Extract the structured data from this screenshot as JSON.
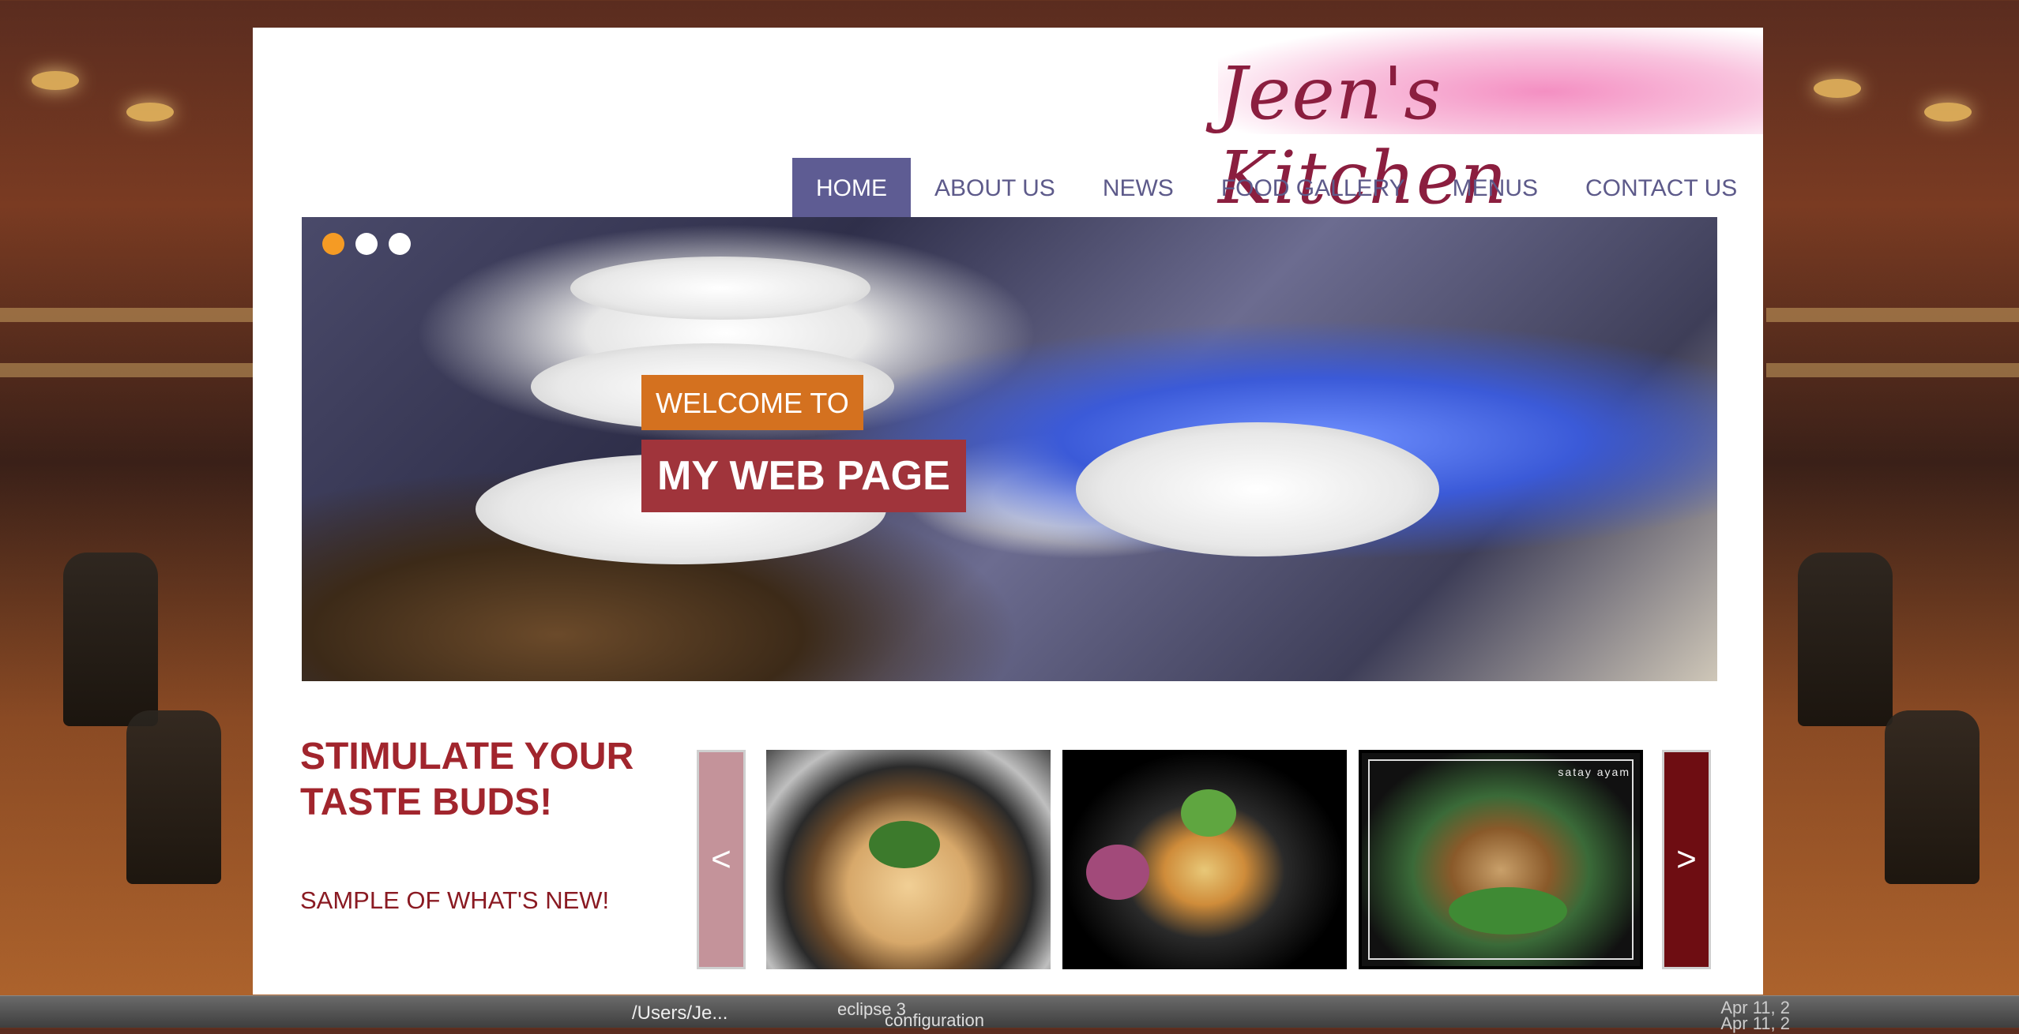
{
  "site": {
    "brand": "Jeen's Kitchen"
  },
  "nav": {
    "items": [
      {
        "label": "HOME",
        "active": true
      },
      {
        "label": "ABOUT US",
        "active": false
      },
      {
        "label": "NEWS",
        "active": false
      },
      {
        "label": "FOOD GALLERY",
        "active": false
      },
      {
        "label": "MENUS",
        "active": false
      },
      {
        "label": "CONTACT US",
        "active": false
      }
    ]
  },
  "hero": {
    "welcome": "WELCOME TO",
    "title": "MY WEB PAGE",
    "dots": 3,
    "active_dot": 0
  },
  "promo": {
    "headline": "STIMULATE YOUR TASTE BUDS!",
    "subheadline": "SAMPLE OF WHAT'S NEW!"
  },
  "carousel": {
    "prev_label": "<",
    "next_label": ">",
    "thumbs": [
      {
        "icon": "claypot-dish-photo"
      },
      {
        "icon": "noodle-bowl-photo"
      },
      {
        "icon": "satay-photo",
        "caption": "satay ayam"
      }
    ]
  },
  "taskbar": {
    "path": "/Users/Je...",
    "folder": "eclipse 3",
    "subfolder": "configuration",
    "date1": "Apr 11, 2",
    "date2": "Apr 11, 2"
  },
  "colors": {
    "nav_active": "#5e5c93",
    "nav_text": "#5d5a8a",
    "welcome_bg": "#d4711f",
    "title_bg": "#a0343b",
    "headline": "#a1252d",
    "dot_active": "#f59b24",
    "next_btn": "#6e0d12",
    "prev_btn": "#c4939a"
  }
}
